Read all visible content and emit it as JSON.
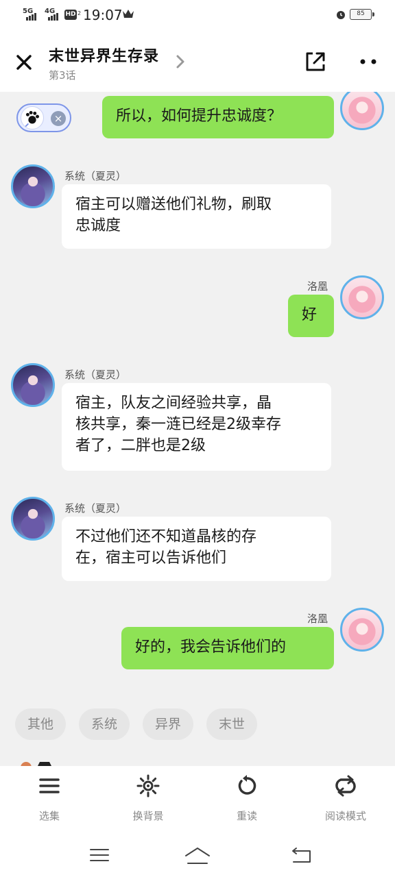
{
  "status_bar": {
    "network_1": "5G",
    "network_2": "4G",
    "hd": "HD",
    "hd_sub": "2",
    "time": "19:07",
    "battery": "85"
  },
  "header": {
    "title": "末世异界生存录",
    "chapter": "第3话"
  },
  "messages": [
    {
      "role": "user",
      "sender": "",
      "text": "所以，如何提升忠诚度？"
    },
    {
      "role": "system",
      "sender": "系统（夏灵）",
      "lines": [
        "宿主可以赠送他们礼物，刷取",
        "忠诚度"
      ]
    },
    {
      "role": "user",
      "sender": "洛凰",
      "text": "好"
    },
    {
      "role": "system",
      "sender": "系统（夏灵）",
      "lines": [
        "宿主，队友之间经验共享，晶",
        "核共享，秦一涟已经是2级幸存",
        "者了，二胖也是2级"
      ]
    },
    {
      "role": "system",
      "sender": "系统（夏灵）",
      "lines": [
        "不过他们还不知道晶核的存",
        "在，宿主可以告诉他们"
      ]
    },
    {
      "role": "user",
      "sender": "洛凰",
      "text": "好的，我会告诉他们的"
    }
  ],
  "tags": [
    "其他",
    "系统",
    "异界",
    "末世"
  ],
  "toolbar": [
    {
      "label": "选集",
      "icon": "list-icon"
    },
    {
      "label": "换背景",
      "icon": "brightness-icon"
    },
    {
      "label": "重读",
      "icon": "replay-icon"
    },
    {
      "label": "阅读模式",
      "icon": "loop-icon"
    }
  ],
  "colors": {
    "user_bubble": "#8ee255",
    "system_bubble": "#ffffff",
    "avatar_border": "#5fb2ea",
    "background": "#f1f1f1"
  }
}
